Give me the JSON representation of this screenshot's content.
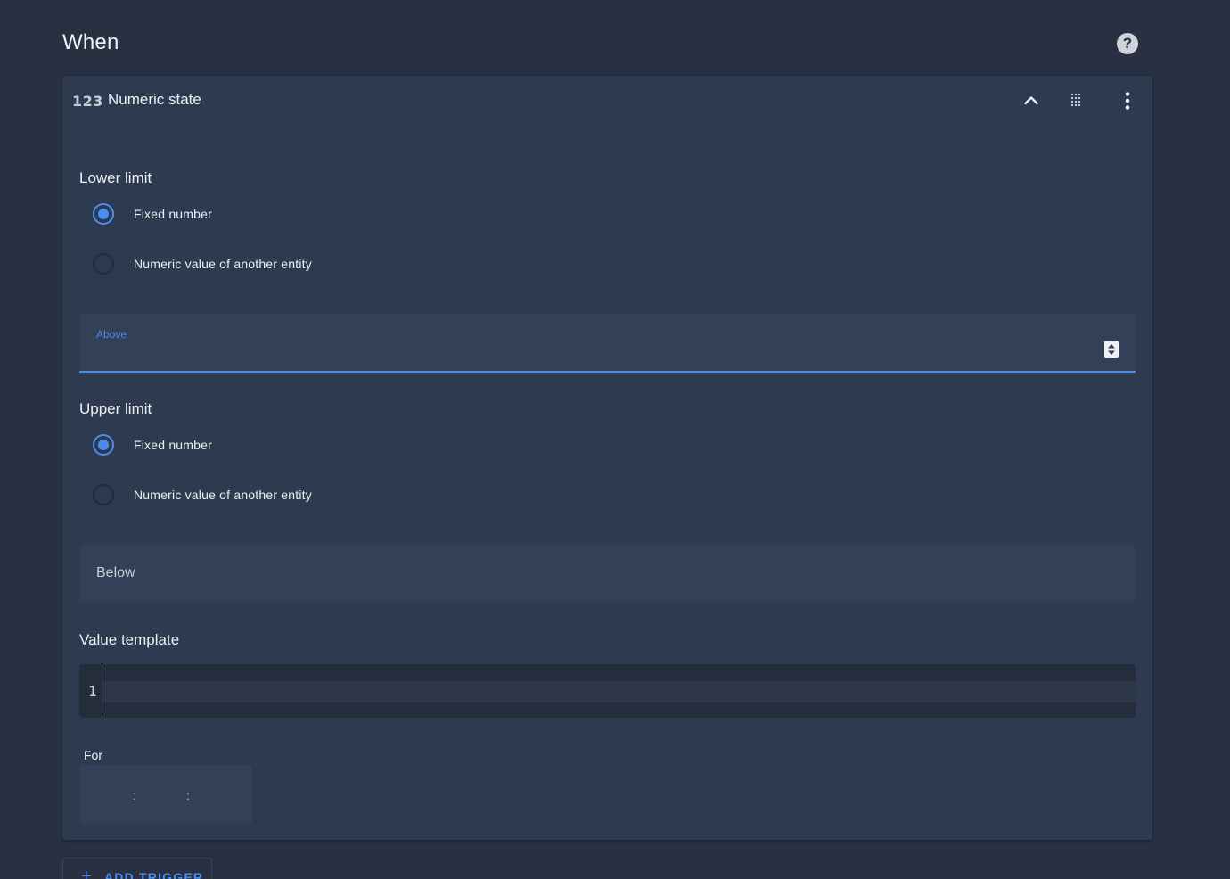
{
  "section": {
    "title": "When",
    "help_icon": "help-circle-icon"
  },
  "trigger": {
    "icon": "numeric-123-icon",
    "icon_text": "123",
    "title": "Numeric state",
    "header_icons": [
      "chevron-up-icon",
      "drag-handle-icon",
      "more-vertical-icon"
    ]
  },
  "lower_limit": {
    "label": "Lower limit",
    "options": [
      {
        "label": "Fixed number",
        "checked": true
      },
      {
        "label": "Numeric value of another entity",
        "checked": false
      }
    ],
    "above_field": {
      "label": "Above",
      "value": ""
    }
  },
  "upper_limit": {
    "label": "Upper limit",
    "options": [
      {
        "label": "Fixed number",
        "checked": true
      },
      {
        "label": "Numeric value of another entity",
        "checked": false
      }
    ],
    "below_field": {
      "label": "Below",
      "value": ""
    }
  },
  "value_template": {
    "label": "Value template",
    "line_number": "1",
    "content": ""
  },
  "for_field": {
    "label": "For",
    "separators": [
      ":",
      ":"
    ]
  },
  "add_trigger": {
    "label": "ADD TRIGGER",
    "icon": "plus-icon"
  },
  "colors": {
    "background": "#283042",
    "card": "#2d3a4f",
    "field": "#334058",
    "accent": "#4a8cf0"
  }
}
